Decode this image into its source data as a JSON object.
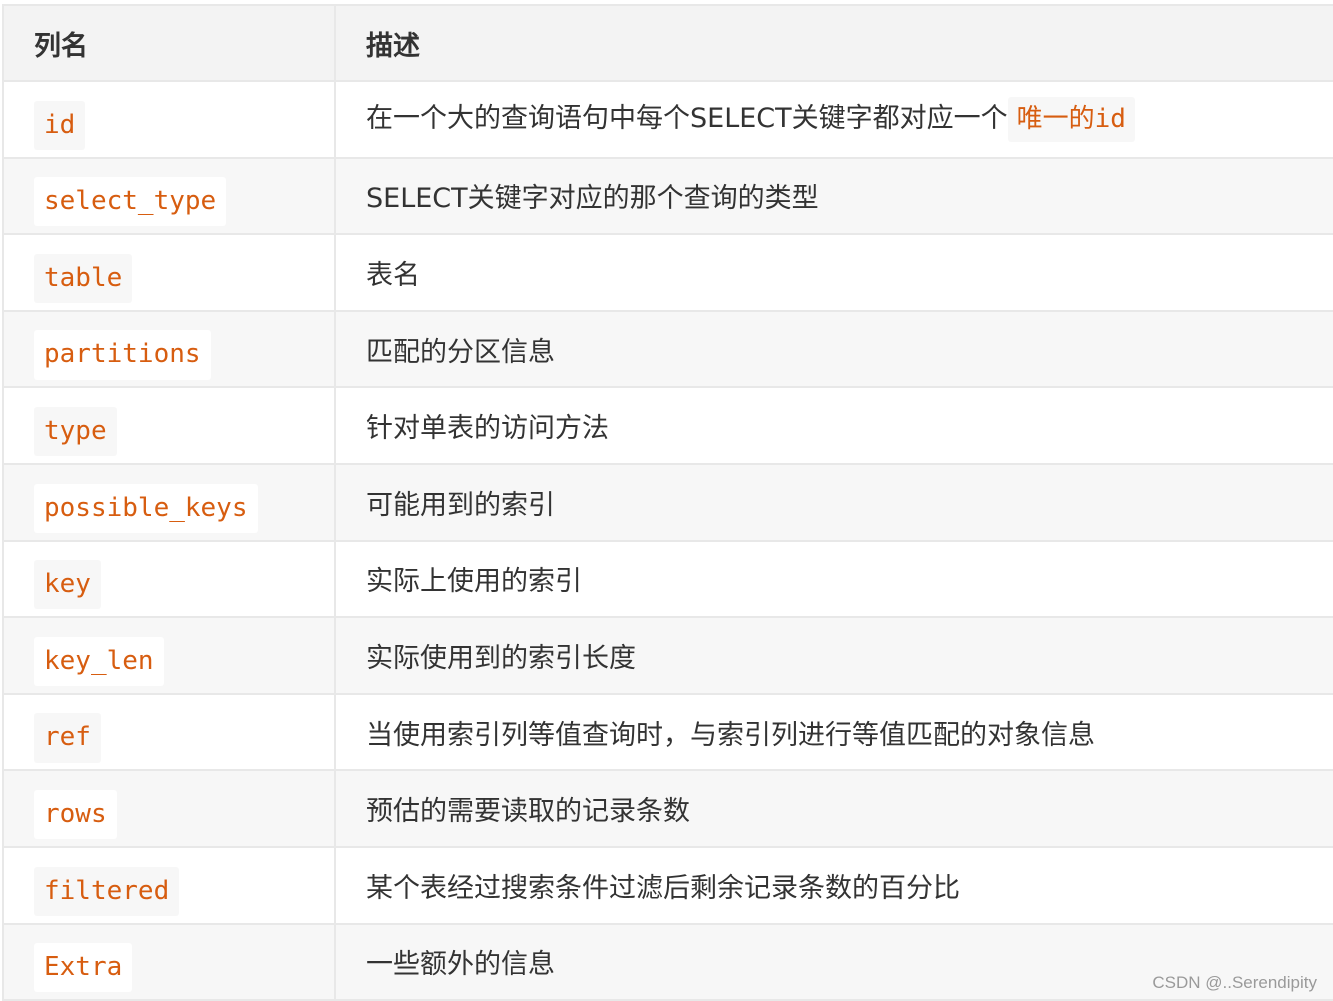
{
  "table": {
    "headers": {
      "column_name": "列名",
      "description": "描述"
    },
    "rows": [
      {
        "column": "id",
        "description": "在一个大的查询语句中每个SELECT关键字都对应一个",
        "inline_code": "唯一的id"
      },
      {
        "column": "select_type",
        "description": "SELECT关键字对应的那个查询的类型"
      },
      {
        "column": "table",
        "description": "表名"
      },
      {
        "column": "partitions",
        "description": "匹配的分区信息"
      },
      {
        "column": "type",
        "description": "针对单表的访问方法"
      },
      {
        "column": "possible_keys",
        "description": "可能用到的索引"
      },
      {
        "column": "key",
        "description": "实际上使用的索引"
      },
      {
        "column": "key_len",
        "description": "实际使用到的索引长度"
      },
      {
        "column": "ref",
        "description": "当使用索引列等值查询时，与索引列进行等值匹配的对象信息"
      },
      {
        "column": "rows",
        "description": "预估的需要读取的记录条数"
      },
      {
        "column": "filtered",
        "description": "某个表经过搜索条件过滤后剩余记录条数的百分比"
      },
      {
        "column": "Extra",
        "description": "一些额外的信息"
      }
    ]
  },
  "watermark": "CSDN @..Serendipity",
  "colors": {
    "code_text": "#d75d10",
    "header_bg": "#f3f3f3",
    "stripe_bg": "#f7f7f7",
    "border": "#e8e8e8"
  }
}
